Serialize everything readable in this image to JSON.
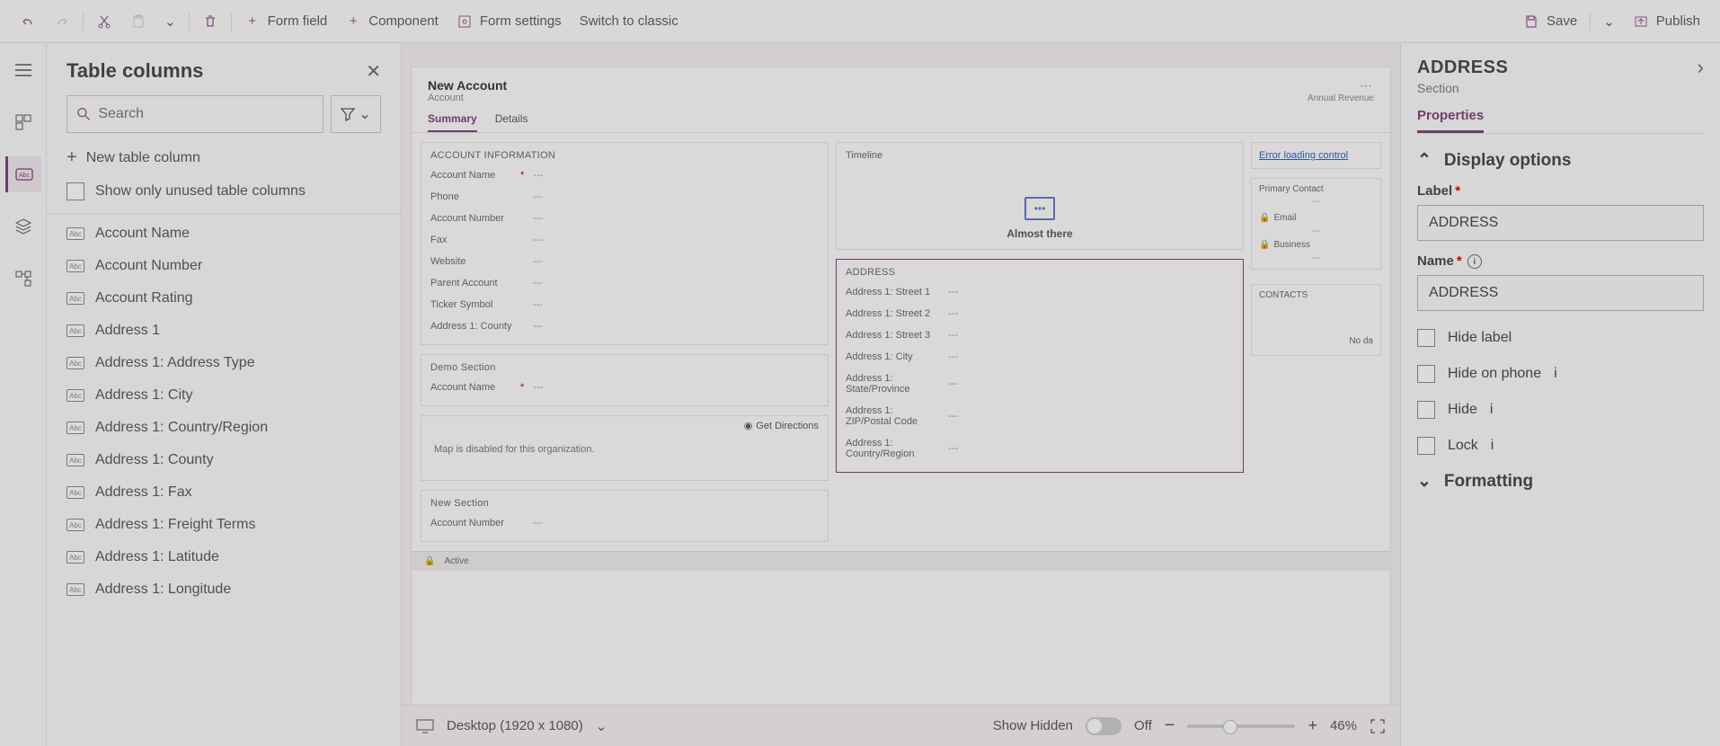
{
  "toolbar": {
    "form_field": "Form field",
    "component": "Component",
    "form_settings": "Form settings",
    "switch_classic": "Switch to classic",
    "save": "Save",
    "publish": "Publish"
  },
  "leftpanel": {
    "title": "Table columns",
    "search_placeholder": "Search",
    "new_column": "New table column",
    "show_unused": "Show only unused table columns",
    "items": [
      "Account Name",
      "Account Number",
      "Account Rating",
      "Address 1",
      "Address 1: Address Type",
      "Address 1: City",
      "Address 1: Country/Region",
      "Address 1: County",
      "Address 1: Fax",
      "Address 1: Freight Terms",
      "Address 1: Latitude",
      "Address 1: Longitude"
    ]
  },
  "canvas": {
    "form_title": "New Account",
    "form_entity": "Account",
    "annual_rev": "Annual Revenue",
    "tabs": [
      "Summary",
      "Details"
    ],
    "sec_account_info": "ACCOUNT INFORMATION",
    "acc_fields": [
      {
        "l": "Account Name",
        "r": "*",
        "v": "---"
      },
      {
        "l": "Phone",
        "r": "",
        "v": "---"
      },
      {
        "l": "Account Number",
        "r": "",
        "v": "---"
      },
      {
        "l": "Fax",
        "r": "",
        "v": "---"
      },
      {
        "l": "Website",
        "r": "",
        "v": "---"
      },
      {
        "l": "Parent Account",
        "r": "",
        "v": "---"
      },
      {
        "l": "Ticker Symbol",
        "r": "",
        "v": "---"
      },
      {
        "l": "Address 1: County",
        "r": "",
        "v": "---"
      }
    ],
    "sec_demo": "Demo Section",
    "demo_fields": [
      {
        "l": "Account Name",
        "r": "*",
        "v": "---"
      }
    ],
    "get_directions": "Get Directions",
    "map_disabled": "Map is disabled for this organization.",
    "sec_new": "New Section",
    "new_fields": [
      {
        "l": "Account Number",
        "r": "",
        "v": "---"
      }
    ],
    "timeline": "Timeline",
    "almost_there": "Almost there",
    "sec_address": "ADDRESS",
    "addr_fields": [
      {
        "l": "Address 1: Street 1",
        "v": "---"
      },
      {
        "l": "Address 1: Street 2",
        "v": "---"
      },
      {
        "l": "Address 1: Street 3",
        "v": "---"
      },
      {
        "l": "Address 1: City",
        "v": "---"
      },
      {
        "l": "Address 1: State/Province",
        "v": "---"
      },
      {
        "l": "Address 1: ZIP/Postal Code",
        "v": "---"
      },
      {
        "l": "Address 1: Country/Region",
        "v": "---"
      }
    ],
    "error_link": "Error loading control",
    "primary_contact": "Primary Contact",
    "email_lbl": "Email",
    "business_lbl": "Business",
    "contacts": "CONTACTS",
    "no_data": "No da",
    "status_active": "Active",
    "foot_device": "Desktop (1920 x 1080)",
    "show_hidden": "Show Hidden",
    "off": "Off",
    "zoom": "46%"
  },
  "right": {
    "title": "ADDRESS",
    "subtitle": "Section",
    "tab_props": "Properties",
    "display_options": "Display options",
    "label_lbl": "Label",
    "label_val": "ADDRESS",
    "name_lbl": "Name",
    "name_val": "ADDRESS",
    "hide_label": "Hide label",
    "hide_phone": "Hide on phone",
    "hide": "Hide",
    "lock": "Lock",
    "formatting": "Formatting"
  }
}
